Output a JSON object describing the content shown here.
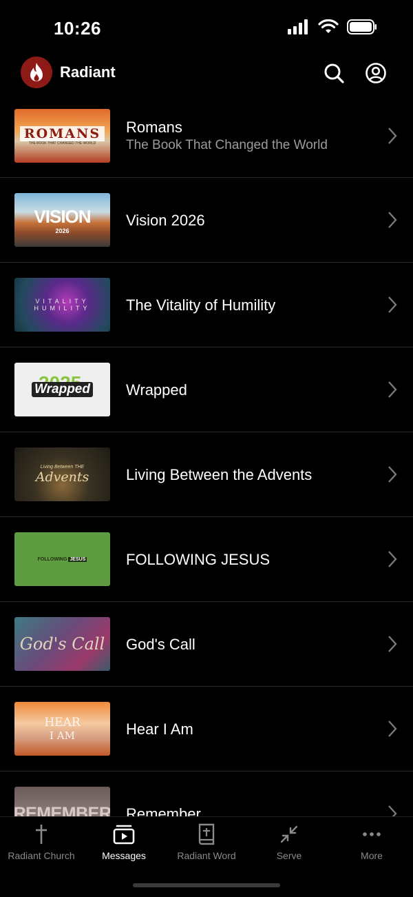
{
  "status_bar": {
    "time": "10:26",
    "icons": [
      "cellular-signal-icon",
      "wifi-icon",
      "battery-icon"
    ]
  },
  "header": {
    "app_name": "Radiant",
    "logo_icon": "flame-icon",
    "actions": [
      "search-icon",
      "account-icon"
    ],
    "brand_color": "#8e1a16"
  },
  "series": [
    {
      "title": "Romans",
      "subtitle": "The Book That Changed the World",
      "thumb_text": "ROMANS",
      "thumb_sub": "THE BOOK THAT CHANGED THE WORLD"
    },
    {
      "title": "Vision 2026",
      "subtitle": "",
      "thumb_text": "VISION",
      "thumb_sub": "2026"
    },
    {
      "title": "The Vitality of Humility",
      "subtitle": "",
      "thumb_text": "VITALITY",
      "thumb_sub": "HUMILITY"
    },
    {
      "title": "Wrapped",
      "subtitle": "",
      "thumb_text": "Wrapped",
      "thumb_sub": "2025"
    },
    {
      "title": "Living Between the Advents",
      "subtitle": "",
      "thumb_text": "Advents",
      "thumb_sub": "Living Between THE"
    },
    {
      "title": "FOLLOWING JESUS",
      "subtitle": "",
      "thumb_text": "FOLLOWING",
      "thumb_sub": "JESUS"
    },
    {
      "title": "God's Call",
      "subtitle": "",
      "thumb_text": "God's Call",
      "thumb_sub": ""
    },
    {
      "title": "Hear I Am",
      "subtitle": "",
      "thumb_text": "HEAR",
      "thumb_sub": "I AM"
    },
    {
      "title": "Remember",
      "subtitle": "",
      "thumb_text": "REMEMBER",
      "thumb_sub": ""
    }
  ],
  "tabs": [
    {
      "label": "Radiant Church",
      "icon": "cross-icon",
      "active": false
    },
    {
      "label": "Messages",
      "icon": "play-video-icon",
      "active": true
    },
    {
      "label": "Radiant Word",
      "icon": "bible-icon",
      "active": false
    },
    {
      "label": "Serve",
      "icon": "arrows-inward-icon",
      "active": false
    },
    {
      "label": "More",
      "icon": "more-dots-icon",
      "active": false
    }
  ]
}
